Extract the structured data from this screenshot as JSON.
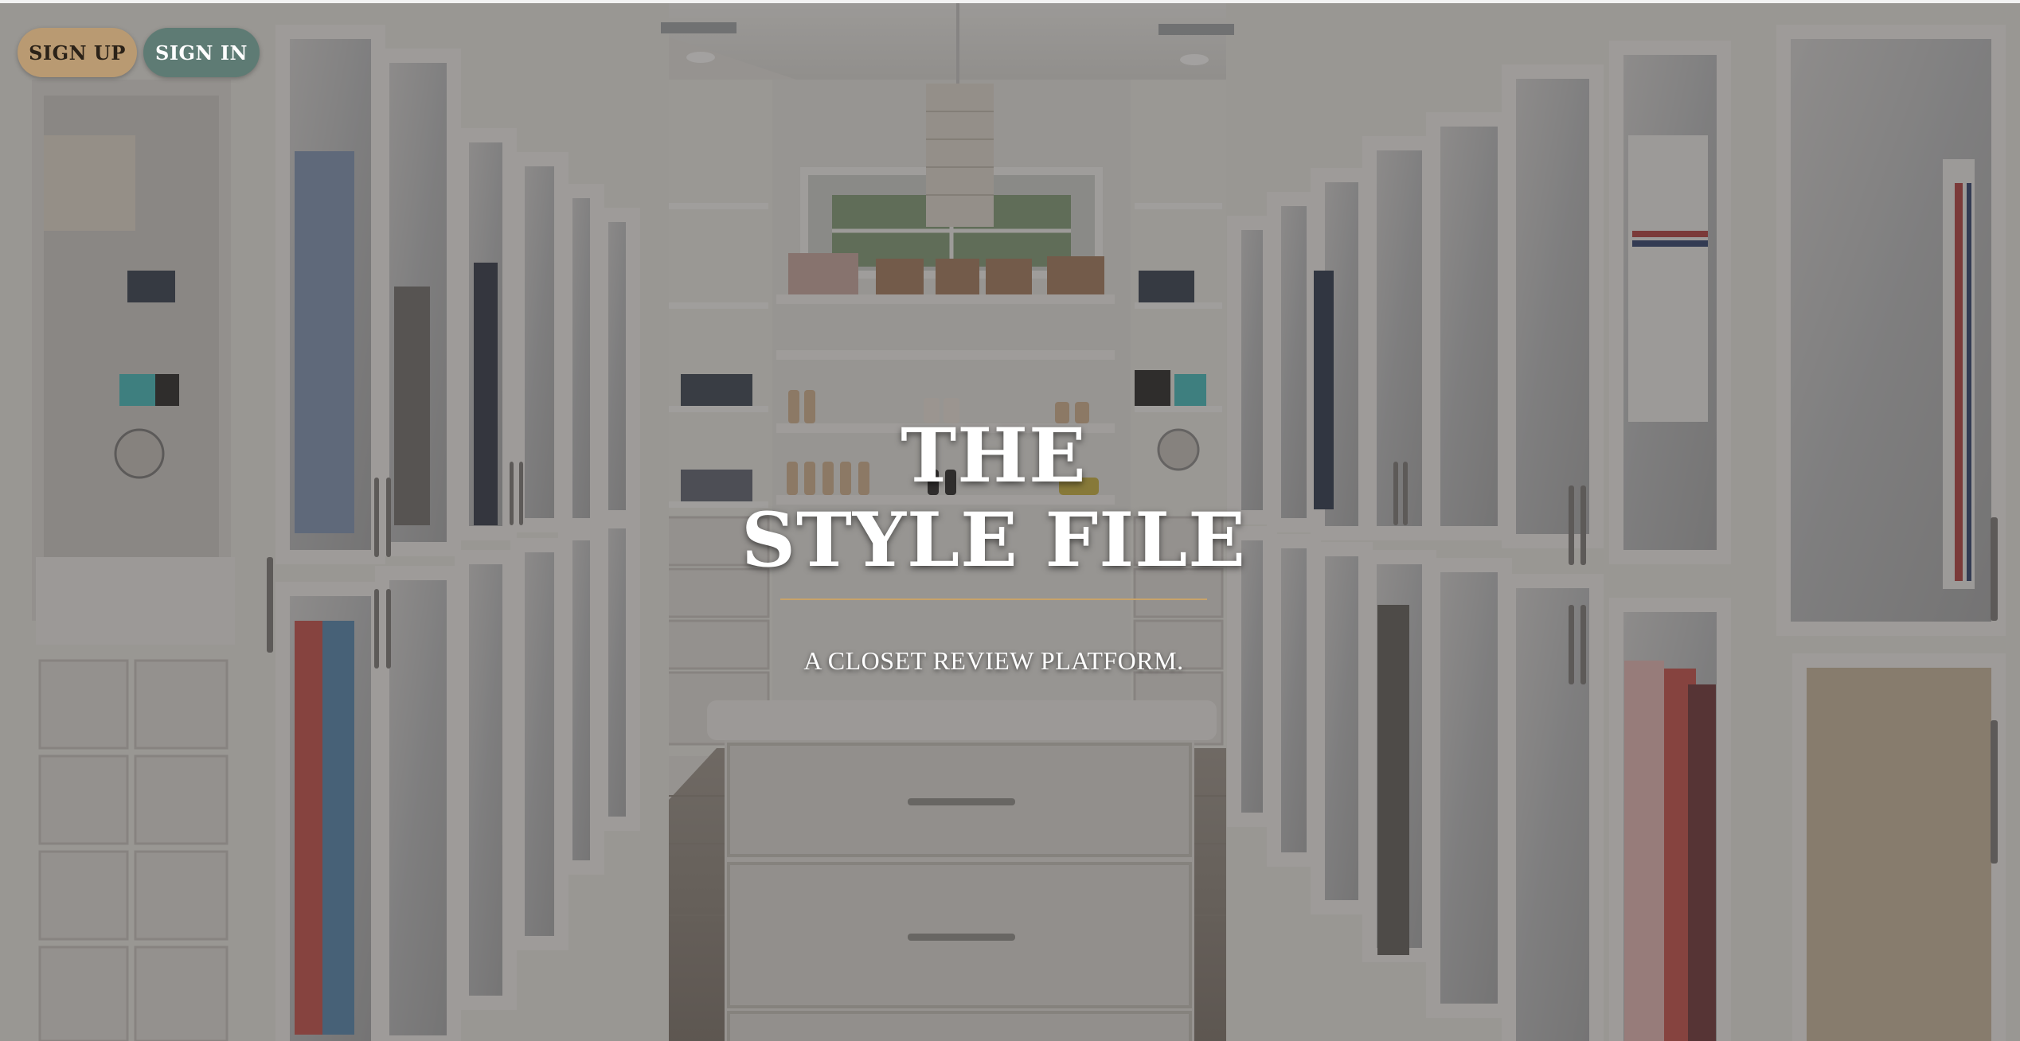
{
  "auth": {
    "signup_label": "SIGN UP",
    "signin_label": "SIGN IN"
  },
  "hero": {
    "title_line1": "THE",
    "title_line2": "STYLE FILE",
    "tagline": "A CLOSET REVIEW PLATFORM."
  },
  "colors": {
    "signup_bg": "#b99a72",
    "signin_bg": "#5e7b74",
    "accent_rule": "#c8a36a",
    "overlay": "#4a4744"
  },
  "background": {
    "icon": "walk-in-closet-photo"
  }
}
